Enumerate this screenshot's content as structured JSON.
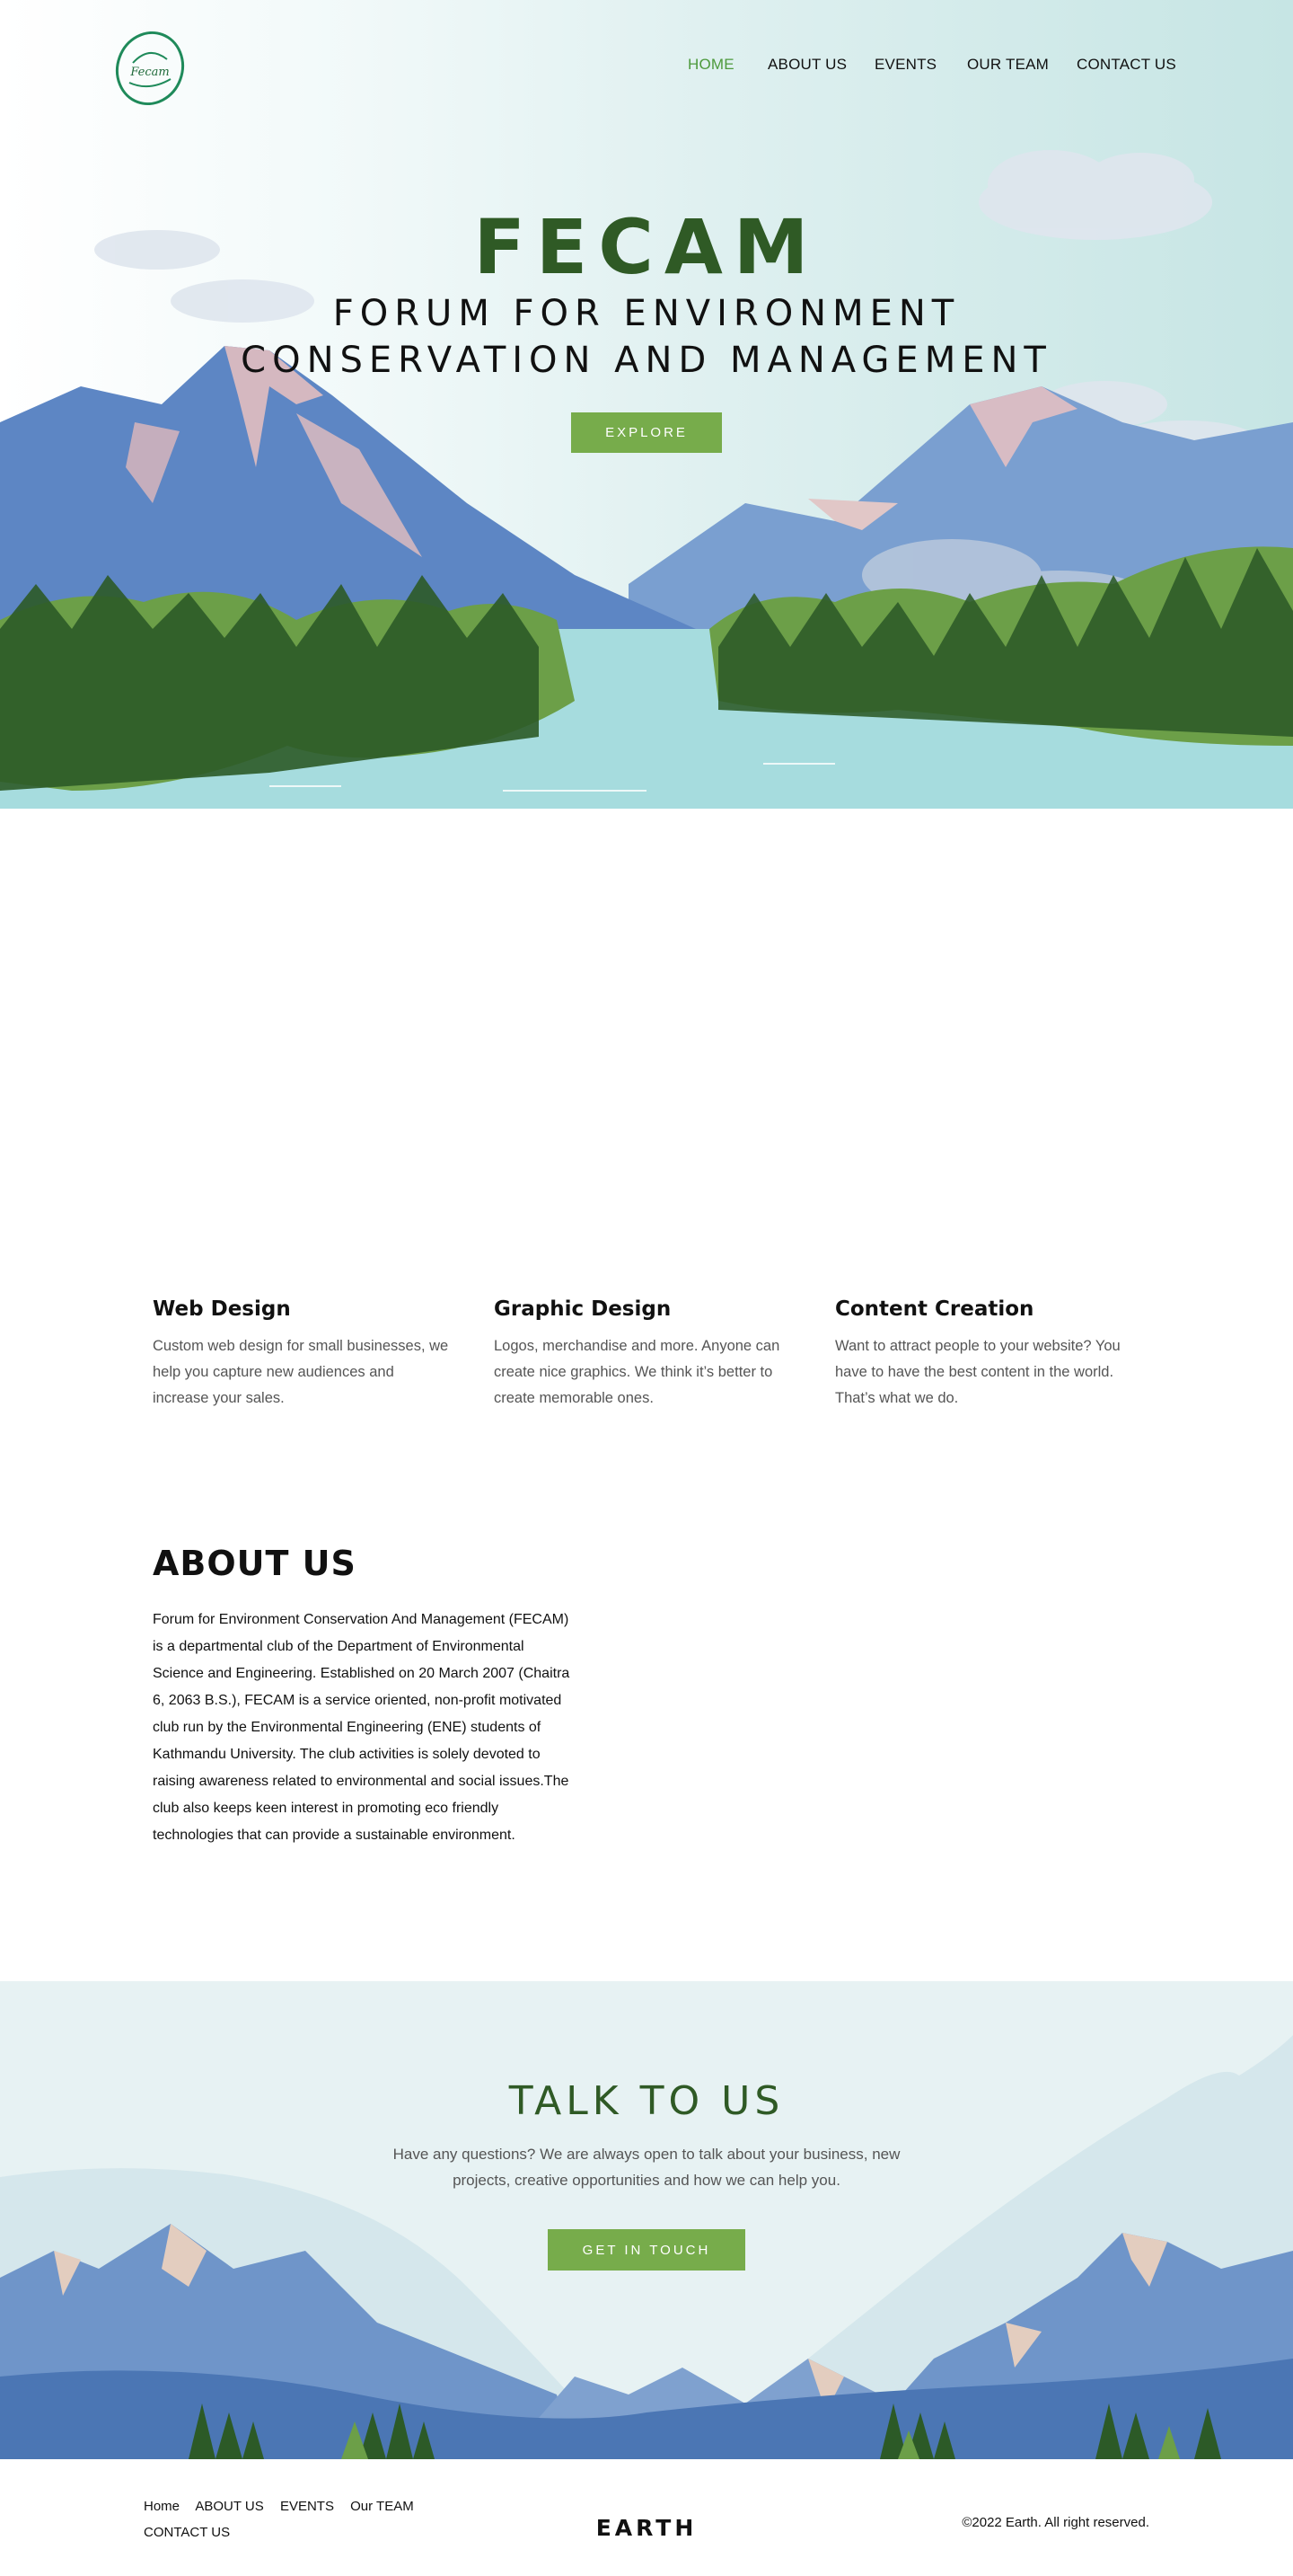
{
  "nav": {
    "items": [
      {
        "label": "HOME",
        "active": true
      },
      {
        "label": "ABOUT US",
        "active": false
      },
      {
        "label": "EVENTS",
        "active": false
      },
      {
        "label": "OUR TEAM",
        "active": false
      },
      {
        "label": "CONTACT US",
        "active": false
      }
    ]
  },
  "logo": {
    "text": "Fecam"
  },
  "hero": {
    "title": "FECAM",
    "subtitle_line1": "FORUM FOR ENVIRONMENT",
    "subtitle_line2": "CONSERVATION AND MANAGEMENT",
    "button_label": "EXPLORE"
  },
  "services": [
    {
      "title": "Web Design",
      "text": "Custom web design for small businesses, we help you capture new audiences and increase your sales."
    },
    {
      "title": "Graphic Design",
      "text": "Logos, merchandise and more. Anyone can create nice graphics. We think it’s better to create memorable ones."
    },
    {
      "title": "Content Creation",
      "text": "Want to attract people to your website? You have to have the best content in the world. That’s what we do."
    }
  ],
  "about": {
    "title": "ABOUT US",
    "text": "Forum for Environment Conservation And Management (FECAM) is a departmental club of the Department of Environmental Science and Engineering. Established on 20 March 2007 (Chaitra 6, 2063 B.S.), FECAM is a service oriented, non-profit motivated club run by the Environmental Engineering (ENE) students of Kathmandu University. The club activities is solely devoted to raising awareness related to environmental and social issues.The club also keeps keen interest in promoting eco friendly technologies that can provide a sustainable environment."
  },
  "contact": {
    "title": "TALK TO US",
    "text": "Have any questions? We are always open to talk about your business, new projects, creative opportunities and how we can help you.",
    "button_label": "GET IN TOUCH"
  },
  "footer": {
    "links": [
      "Home",
      "ABOUT US",
      "EVENTS",
      "Our TEAM",
      "CONTACT US"
    ],
    "brand": "EARTH",
    "copyright": "©2022 Earth. All right reserved."
  },
  "colors": {
    "accent_green": "#77ac4b",
    "title_green": "#2f5a25",
    "nav_active": "#4d9a3c"
  }
}
